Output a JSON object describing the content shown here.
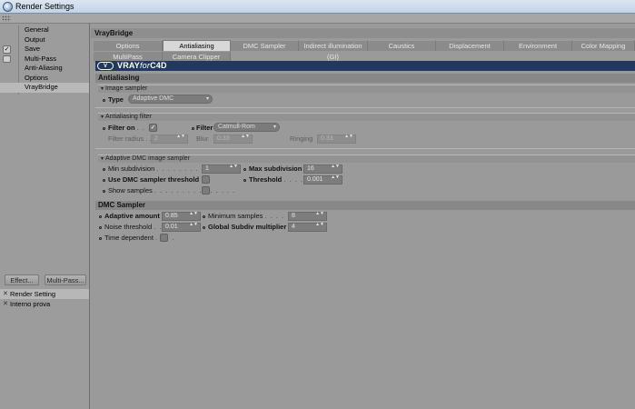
{
  "window": {
    "title": "Render Settings"
  },
  "sidebar": {
    "items": [
      {
        "label": "General",
        "checked": false,
        "has_check": false
      },
      {
        "label": "Output",
        "checked": false,
        "has_check": false
      },
      {
        "label": "Save",
        "checked": true,
        "has_check": true
      },
      {
        "label": "Multi-Pass",
        "checked": false,
        "has_check": true
      },
      {
        "label": "Anti-Aliasing",
        "checked": false,
        "has_check": false
      },
      {
        "label": "Options",
        "checked": false,
        "has_check": false
      },
      {
        "label": "VrayBridge",
        "checked": false,
        "has_check": false,
        "selected": true
      }
    ],
    "effect_button": "Effect...",
    "multipass_button": "Multi-Pass...",
    "settings": [
      {
        "label": "Render Setting",
        "active": true
      },
      {
        "label": "Interno prova",
        "active": false
      }
    ]
  },
  "panel": {
    "header": "VrayBridge",
    "tabs_row1": [
      "Options",
      "Antialiasing",
      "DMC Sampler",
      "Indirect illumination (GI)",
      "Caustics",
      "Displacement",
      "Environment",
      "Color Mapping"
    ],
    "tabs_row2": [
      "MultiPass",
      "Camera Clipper"
    ],
    "active_tab": "Antialiasing",
    "logo": {
      "brand": "VRAY",
      "for": "for",
      "product": "C4D",
      "mark": "V"
    }
  },
  "antialiasing": {
    "section": "Antialiasing",
    "image_sampler": {
      "title": "Image sampler",
      "type_label": "Type",
      "type_value": "Adaptive DMC"
    },
    "aa_filter": {
      "title": "Antialiasing filter",
      "filter_on_label": "Filter on",
      "filter_on_dots": ". . .",
      "filter_on_checked": true,
      "filter_label": "Filter",
      "filter_value": "Catmull-Rom",
      "radius_label": "Filter radius",
      "radius_dots": ". .",
      "radius_value": "2",
      "blur_label": "Blur",
      "blur_value": "0.33",
      "ringing_label": "Ringing",
      "ringing_value": "0.33"
    },
    "dmc_image_sampler": {
      "title": "Adaptive DMC image sampler",
      "min_sub_label": "Min subdivision",
      "min_sub_dots": ". . . . . . . . . . . . . . .",
      "min_sub_value": "1",
      "max_sub_label": "Max subdivision",
      "max_sub_value": "16",
      "use_dmc_label": "Use DMC sampler threshold",
      "use_dmc_checked": false,
      "threshold_label": "Threshold",
      "threshold_dots": ". . . . .",
      "threshold_value": "0.001",
      "show_samples_label": "Show samples",
      "show_samples_dots": ". . . . . . . . . . . . . . .",
      "show_samples_checked": false
    }
  },
  "dmc_sampler": {
    "section": "DMC Sampler",
    "adaptive_amount_label": "Adaptive amount",
    "adaptive_amount_value": "0.85",
    "min_samples_label": "Minimum samples",
    "min_samples_dots": ". . . . . . . . .",
    "min_samples_value": "8",
    "noise_label": "Noise threshold",
    "noise_dots": ". . .",
    "noise_value": "0.01",
    "global_subdiv_label": "Global Subdiv multiplier",
    "global_subdiv_value": "4",
    "time_dependent_label": "Time dependent",
    "time_dependent_dots": ". . . .",
    "time_dependent_checked": false
  },
  "icons": {
    "app": "app-icon",
    "grip": "grip-icon",
    "check": "✓",
    "dropdown": "▾",
    "spinner": "▲▼",
    "tri": "▾",
    "cross": "✕"
  },
  "colors": {
    "banner": "#23385e",
    "active_tab": "#d8d8d8",
    "panel_bg": "#9a9a9a"
  }
}
